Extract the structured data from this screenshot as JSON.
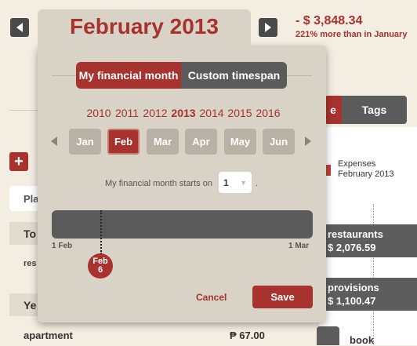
{
  "header": {
    "total": "- $ 3,848.34",
    "comparison": "221% more than in January"
  },
  "right_panel": {
    "partial_tab": "e",
    "tags_tab": "Tags",
    "legend_title": "Expenses",
    "legend_subtitle": "February 2013",
    "categories": [
      {
        "name": "restaurants",
        "amount": "$ 2,076.59"
      },
      {
        "name": "provisions",
        "amount": "$ 1,100.47"
      },
      {
        "name": "book",
        "amount": ""
      }
    ]
  },
  "left_panel": {
    "add_label": "+",
    "plan_partial": "Pla",
    "total_partial": "To",
    "res_partial": "res",
    "year_partial": "Ye",
    "apartment_label": "apartment",
    "apartment_amount": "₱ 67.00"
  },
  "popover": {
    "title": "February 2013",
    "segmented": {
      "active": "My financial month",
      "inactive": "Custom timespan"
    },
    "years": [
      "2010",
      "2011",
      "2012",
      "2013",
      "2014",
      "2015",
      "2016"
    ],
    "selected_year": "2013",
    "months": [
      "Jan",
      "Feb",
      "Mar",
      "Apr",
      "May",
      "Jun"
    ],
    "selected_month": "Feb",
    "start_label": "My financial month starts on",
    "start_value": "1",
    "start_suffix": ".",
    "timeline": {
      "start": "1 Feb",
      "end": "1 Mar",
      "marker_line1": "Feb",
      "marker_line2": "6",
      "marker_day": 6,
      "days_in_month": 28
    },
    "cancel": "Cancel",
    "save": "Save"
  },
  "colors": {
    "accent": "#a8322e",
    "dark": "#5b5b5b",
    "panel": "#d8d2c7"
  }
}
